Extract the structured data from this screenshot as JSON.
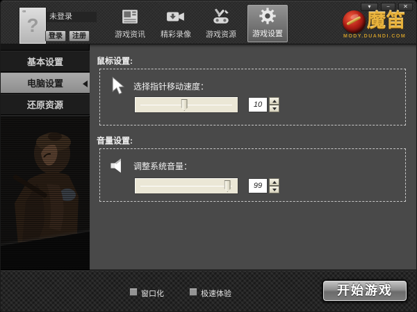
{
  "window": {
    "controls": {
      "menu": "▾",
      "minimize": "−",
      "close": "✕"
    }
  },
  "account": {
    "status": "未登录",
    "avatar_glyph": "?",
    "login_label": "登录",
    "register_label": "注册"
  },
  "nav": {
    "items": [
      {
        "label": "游戏资讯",
        "icon": "news-icon",
        "selected": false
      },
      {
        "label": "精彩录像",
        "icon": "video-icon",
        "selected": false
      },
      {
        "label": "游戏资源",
        "icon": "game-resources-icon",
        "selected": false
      },
      {
        "label": "游戏设置",
        "icon": "gear-icon",
        "selected": true
      }
    ]
  },
  "brand": {
    "name": "魔笛",
    "url": "MODY.DUANDI.COM",
    "accent_red": "#b31f16",
    "accent_gold": "#e9b33c"
  },
  "sidebar": {
    "items": [
      {
        "label": "基本设置",
        "selected": false
      },
      {
        "label": "电脑设置",
        "selected": true
      },
      {
        "label": "还原资源",
        "selected": false
      }
    ]
  },
  "mouse_section": {
    "title": "鼠标设置:",
    "label": "选择指针移动速度：",
    "value": "10",
    "slider_percent": 48
  },
  "volume_section": {
    "title": "音量设置:",
    "label": "调整系统音量：",
    "value": "99",
    "slider_percent": 95
  },
  "footer": {
    "checkboxes": [
      {
        "label": "窗口化",
        "checked": false
      },
      {
        "label": "极速体验",
        "checked": false
      }
    ],
    "start_button": "开始游戏"
  }
}
